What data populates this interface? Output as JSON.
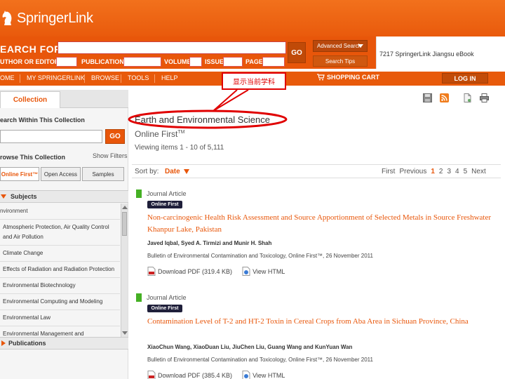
{
  "brand": {
    "logo_text": "SpringerLink",
    "color": "#e8560a"
  },
  "search": {
    "label": "EARCH FOR",
    "value": "",
    "go_label": "GO",
    "fields": [
      {
        "label": "UTHOR OR EDITOR",
        "value": ""
      },
      {
        "label": "PUBLICATION",
        "value": ""
      },
      {
        "label": "VOLUME",
        "value": ""
      },
      {
        "label": "ISSUE",
        "value": ""
      },
      {
        "label": "PAGE",
        "value": ""
      }
    ],
    "advanced_label": "Advanced Search",
    "tips_label": "Search Tips"
  },
  "account": {
    "text": "7217 SpringerLink Jiangsu eBook"
  },
  "nav": {
    "items": [
      "OME",
      "MY SPRINGERLINK",
      "BROWSE",
      "TOOLS",
      "HELP"
    ],
    "cart_label": "SHOPPING CART",
    "login_label": "LOG IN"
  },
  "annotation": {
    "label": "显示当前学科",
    "color": "#e00000"
  },
  "sidebar": {
    "tab_label": "Collection",
    "search_label": "earch Within This Collection",
    "search_value": "",
    "go_label": "GO",
    "browse_label": "rowse This Collection",
    "show_filters": "Show Filters",
    "filter_buttons": [
      "Online First™",
      "Open Access",
      "Samples"
    ],
    "subjects_label": "Subjects",
    "subjects": [
      "nvironment",
      "Atmospheric Protection, Air Quality Control and Air Pollution",
      "Climate Change",
      "Effects of Radiation and Radiation Protection",
      "Environmental Biotechnology",
      "Environmental Computing and Modeling",
      "Environmental Law",
      "Environmental Management and"
    ],
    "publications_label": "Publications"
  },
  "main": {
    "collection_title": "Earth and Environmental Science",
    "subtitle": "Online First",
    "subtitle_tm": "TM",
    "viewing_text": "Viewing items 1 - 10 of 5,111",
    "sort_label": "Sort by:",
    "sort_value": "Date",
    "pager": {
      "first": "First",
      "previous": "Previous",
      "pages": [
        "1",
        "2",
        "3",
        "4",
        "5"
      ],
      "next": "Next"
    },
    "results": [
      {
        "type": "Journal Article",
        "badge": "Online First",
        "title": "Non-carcinogenic Health Risk Assessment and Source Apportionment of Selected Metals in Source Freshwater Khanpur Lake, Pakistan",
        "authors": "Javed Iqbal, Syed A. Tirmizi and Munir H. Shah",
        "source": "Bulletin of Environmental Contamination and Toxicology, Online First™, 26 November 2011",
        "pdf_label": "Download PDF (319.4 KB)",
        "html_label": "View HTML"
      },
      {
        "type": "Journal Article",
        "badge": "Online First",
        "title": "Contamination Level of T-2 and HT-2 Toxin in Cereal Crops from Aba Area in Sichuan Province, China",
        "authors": "XiaoChun Wang, XiaoDuan Liu, JiuChen Liu, Guang Wang and KunYuan Wan",
        "source": "Bulletin of Environmental Contamination and Toxicology, Online First™, 26 November 2011",
        "pdf_label": "Download PDF (385.4 KB)",
        "html_label": "View HTML"
      }
    ]
  }
}
